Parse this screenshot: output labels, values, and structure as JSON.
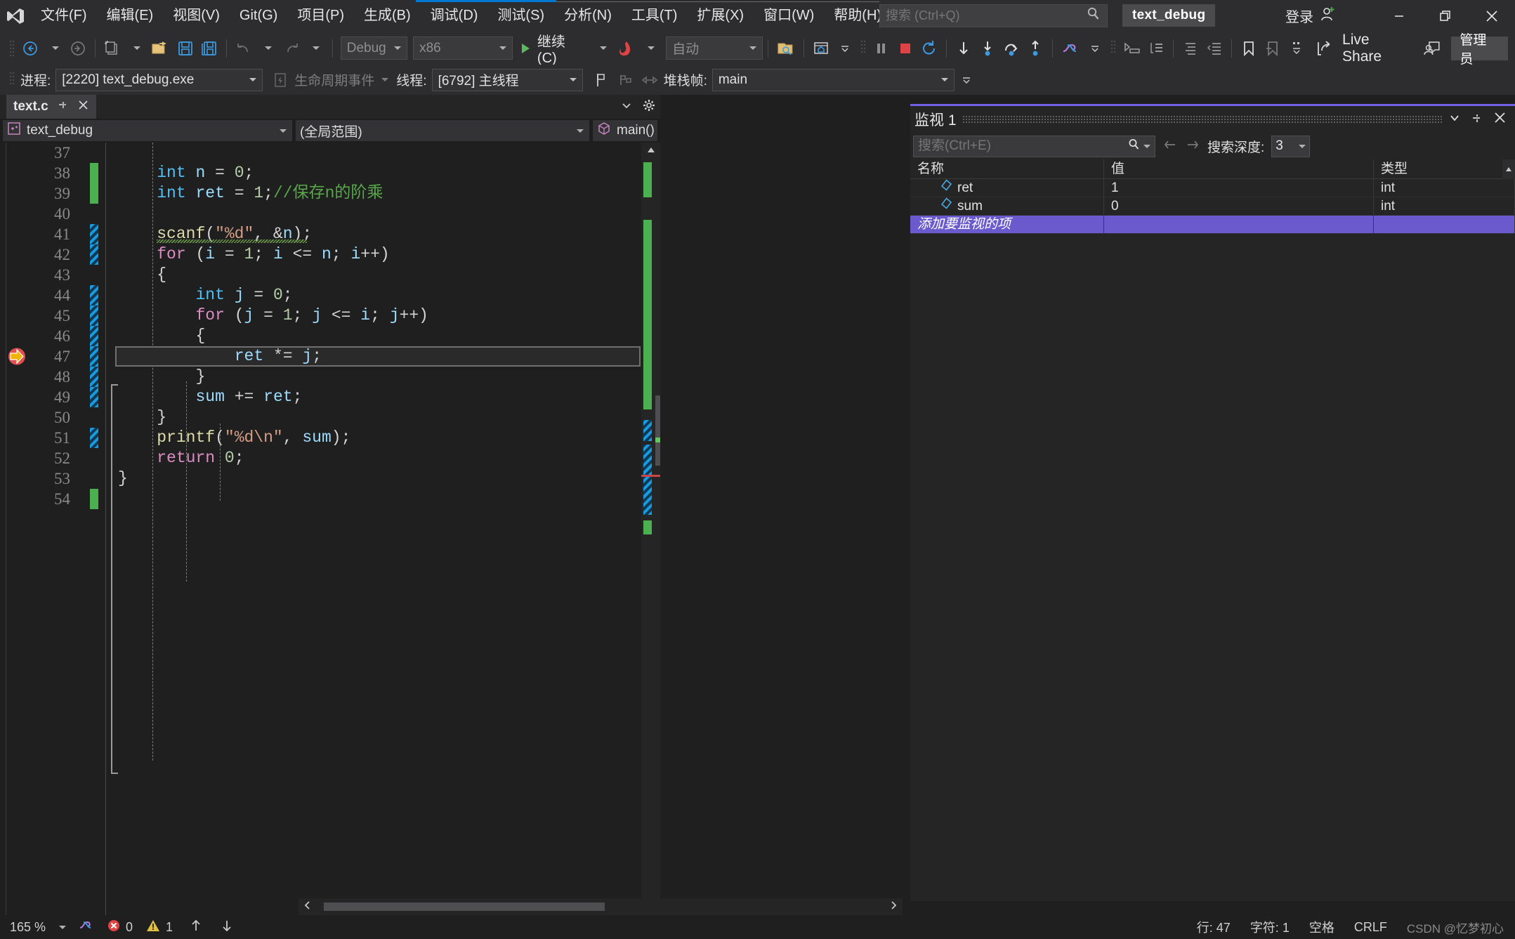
{
  "app": {
    "title": "text_debug",
    "logo_icon": "visual-studio-logo-icon"
  },
  "titlebar": {
    "menus": [
      {
        "label": "文件(F)",
        "name": "menu-file"
      },
      {
        "label": "编辑(E)",
        "name": "menu-edit"
      },
      {
        "label": "视图(V)",
        "name": "menu-view"
      },
      {
        "label": "Git(G)",
        "name": "menu-git"
      },
      {
        "label": "项目(P)",
        "name": "menu-project"
      },
      {
        "label": "生成(B)",
        "name": "menu-build"
      },
      {
        "label": "调试(D)",
        "name": "menu-debug"
      },
      {
        "label": "测试(S)",
        "name": "menu-test"
      },
      {
        "label": "分析(N)",
        "name": "menu-analyze"
      },
      {
        "label": "工具(T)",
        "name": "menu-tools"
      },
      {
        "label": "扩展(X)",
        "name": "menu-extensions"
      },
      {
        "label": "窗口(W)",
        "name": "menu-window"
      },
      {
        "label": "帮助(H)",
        "name": "menu-help"
      }
    ],
    "search_placeholder": "搜索 (Ctrl+Q)",
    "search_value": "",
    "project_chip": "text_debug",
    "signin_label": "登录",
    "minimize_glyph": "—",
    "restore_glyph": "❐",
    "close_glyph": "✕"
  },
  "toolbar": {
    "config": "Debug",
    "platform": "x86",
    "continue_label": "继续(C)",
    "hotreload_target": "自动",
    "liveshare_label": "Live Share",
    "admin_label": "管理员"
  },
  "debugbar": {
    "process_label": "进程:",
    "process_value": "[2220] text_debug.exe",
    "lifecycle_label": "生命周期事件",
    "thread_label": "线程:",
    "thread_value": "[6792] 主线程",
    "stackframe_label": "堆栈帧:",
    "stackframe_value": "main"
  },
  "editor": {
    "tab_name": "text.c",
    "pin_glyph": "⊣",
    "close_glyph": "✕",
    "nav_project": "text_debug",
    "nav_scope": "(全局范围)",
    "nav_member": "main()",
    "current_line": 47,
    "lines": [
      {
        "n": 37,
        "marker": "none",
        "text": ""
      },
      {
        "n": 38,
        "marker": "green",
        "text": "    int n = 0;"
      },
      {
        "n": 39,
        "marker": "green",
        "text": "    int ret = 1;//保存n的阶乘"
      },
      {
        "n": 40,
        "marker": "none",
        "text": ""
      },
      {
        "n": 41,
        "marker": "blue",
        "text": "    scanf(\"%d\", &n);"
      },
      {
        "n": 42,
        "marker": "blue",
        "text": "    for (i = 1; i <= n; i++)"
      },
      {
        "n": 43,
        "marker": "none",
        "text": "    {"
      },
      {
        "n": 44,
        "marker": "blue",
        "text": "        int j = 0;"
      },
      {
        "n": 45,
        "marker": "blue",
        "text": "        for (j = 1; j <= i; j++)"
      },
      {
        "n": 46,
        "marker": "blue",
        "text": "        {"
      },
      {
        "n": 47,
        "marker": "blue",
        "text": "            ret *= j;"
      },
      {
        "n": 48,
        "marker": "blue",
        "text": "        }"
      },
      {
        "n": 49,
        "marker": "blue",
        "text": "        sum += ret;"
      },
      {
        "n": 50,
        "marker": "none",
        "text": "    }"
      },
      {
        "n": 51,
        "marker": "blue",
        "text": "    printf(\"%d\\n\", sum);"
      },
      {
        "n": 52,
        "marker": "none",
        "text": "    return 0;"
      },
      {
        "n": 53,
        "marker": "none",
        "text": "}"
      },
      {
        "n": 54,
        "marker": "green",
        "text": ""
      }
    ]
  },
  "watch": {
    "title": "监视 1",
    "search_placeholder": "搜索(Ctrl+E)",
    "search_value": "",
    "depth_label": "搜索深度:",
    "depth_value": "3",
    "columns": [
      "名称",
      "值",
      "类型"
    ],
    "rows": [
      {
        "name": "ret",
        "value": "1",
        "type": "int"
      },
      {
        "name": "sum",
        "value": "0",
        "type": "int"
      }
    ],
    "add_row_placeholder": "添加要监视的项",
    "dropdown_glyph": "▾",
    "pin_glyph": "⊣",
    "close_glyph": "✕"
  },
  "statusbar": {
    "zoom": "165 %",
    "error_count": "0",
    "warning_count": "1",
    "line_label": "行: 47",
    "col_label": "字符: 1",
    "insert_mode": "空格",
    "line_ending": "CRLF",
    "watermark": "CSDN @忆梦初心"
  },
  "colors": {
    "accent_blue": "#0078d4",
    "watch_accent": "#7160e8",
    "green_change": "#4caf50",
    "blue_change": "#1b9ae0",
    "error_red": "#e04343",
    "warning_yellow": "#e0c040",
    "exec_arrow": "#f0b400"
  }
}
